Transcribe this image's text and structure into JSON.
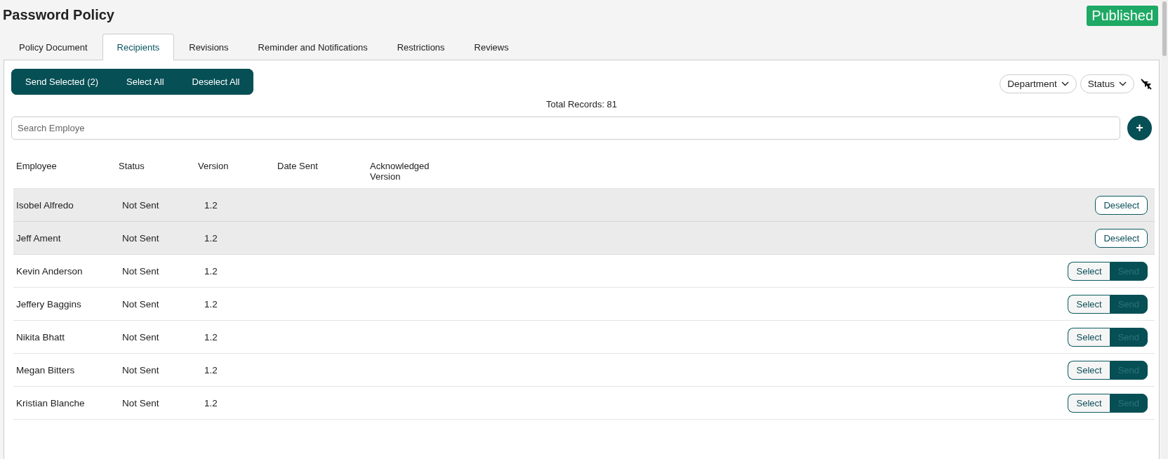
{
  "page": {
    "title": "Password Policy",
    "status_badge": "Published"
  },
  "tabs": [
    {
      "label": "Policy Document",
      "selected": false
    },
    {
      "label": "Recipients",
      "selected": true
    },
    {
      "label": "Revisions",
      "selected": false
    },
    {
      "label": "Reminder and Notifications",
      "selected": false
    },
    {
      "label": "Restrictions",
      "selected": false
    },
    {
      "label": "Reviews",
      "selected": false
    }
  ],
  "bulk_actions": [
    "Send Selected (2)",
    "Select All",
    "Deselect All"
  ],
  "filters": [
    {
      "label": "Department"
    },
    {
      "label": "Status"
    }
  ],
  "total_records": "Total Records: 81",
  "search": {
    "placeholder": "Search Employe"
  },
  "add_button": "+",
  "table": {
    "columns": [
      "Employee",
      "Status",
      "Version",
      "Date Sent",
      "Acknowledged Version"
    ],
    "rows": [
      {
        "employee": "Isobel Alfredo",
        "status": "Not Sent",
        "version": "1.2",
        "selected": true,
        "actions": [
          {
            "kind": "deselect",
            "label": "Deselect"
          }
        ]
      },
      {
        "employee": "Jeff Ament",
        "status": "Not Sent",
        "version": "1.2",
        "selected": true,
        "actions": [
          {
            "kind": "deselect",
            "label": "Deselect"
          }
        ]
      },
      {
        "employee": "Kevin Anderson",
        "status": "Not Sent",
        "version": "1.2",
        "selected": false,
        "actions": [
          {
            "kind": "select",
            "label": "Select"
          },
          {
            "kind": "send",
            "label": "Send",
            "disabled": true
          }
        ]
      },
      {
        "employee": "Jeffery Baggins",
        "status": "Not Sent",
        "version": "1.2",
        "selected": false,
        "actions": [
          {
            "kind": "select",
            "label": "Select"
          },
          {
            "kind": "send",
            "label": "Send",
            "disabled": true
          }
        ]
      },
      {
        "employee": "Nikita Bhatt",
        "status": "Not Sent",
        "version": "1.2",
        "selected": false,
        "actions": [
          {
            "kind": "select",
            "label": "Select"
          },
          {
            "kind": "send",
            "label": "Send",
            "disabled": true
          }
        ]
      },
      {
        "employee": "Megan Bitters",
        "status": "Not Sent",
        "version": "1.2",
        "selected": false,
        "actions": [
          {
            "kind": "select",
            "label": "Select"
          },
          {
            "kind": "send",
            "label": "Send",
            "disabled": true
          }
        ]
      },
      {
        "employee": "Kristian Blanche",
        "status": "Not Sent",
        "version": "1.2",
        "selected": false,
        "actions": [
          {
            "kind": "select",
            "label": "Select"
          },
          {
            "kind": "send",
            "label": "Send",
            "disabled": true
          }
        ]
      }
    ]
  }
}
